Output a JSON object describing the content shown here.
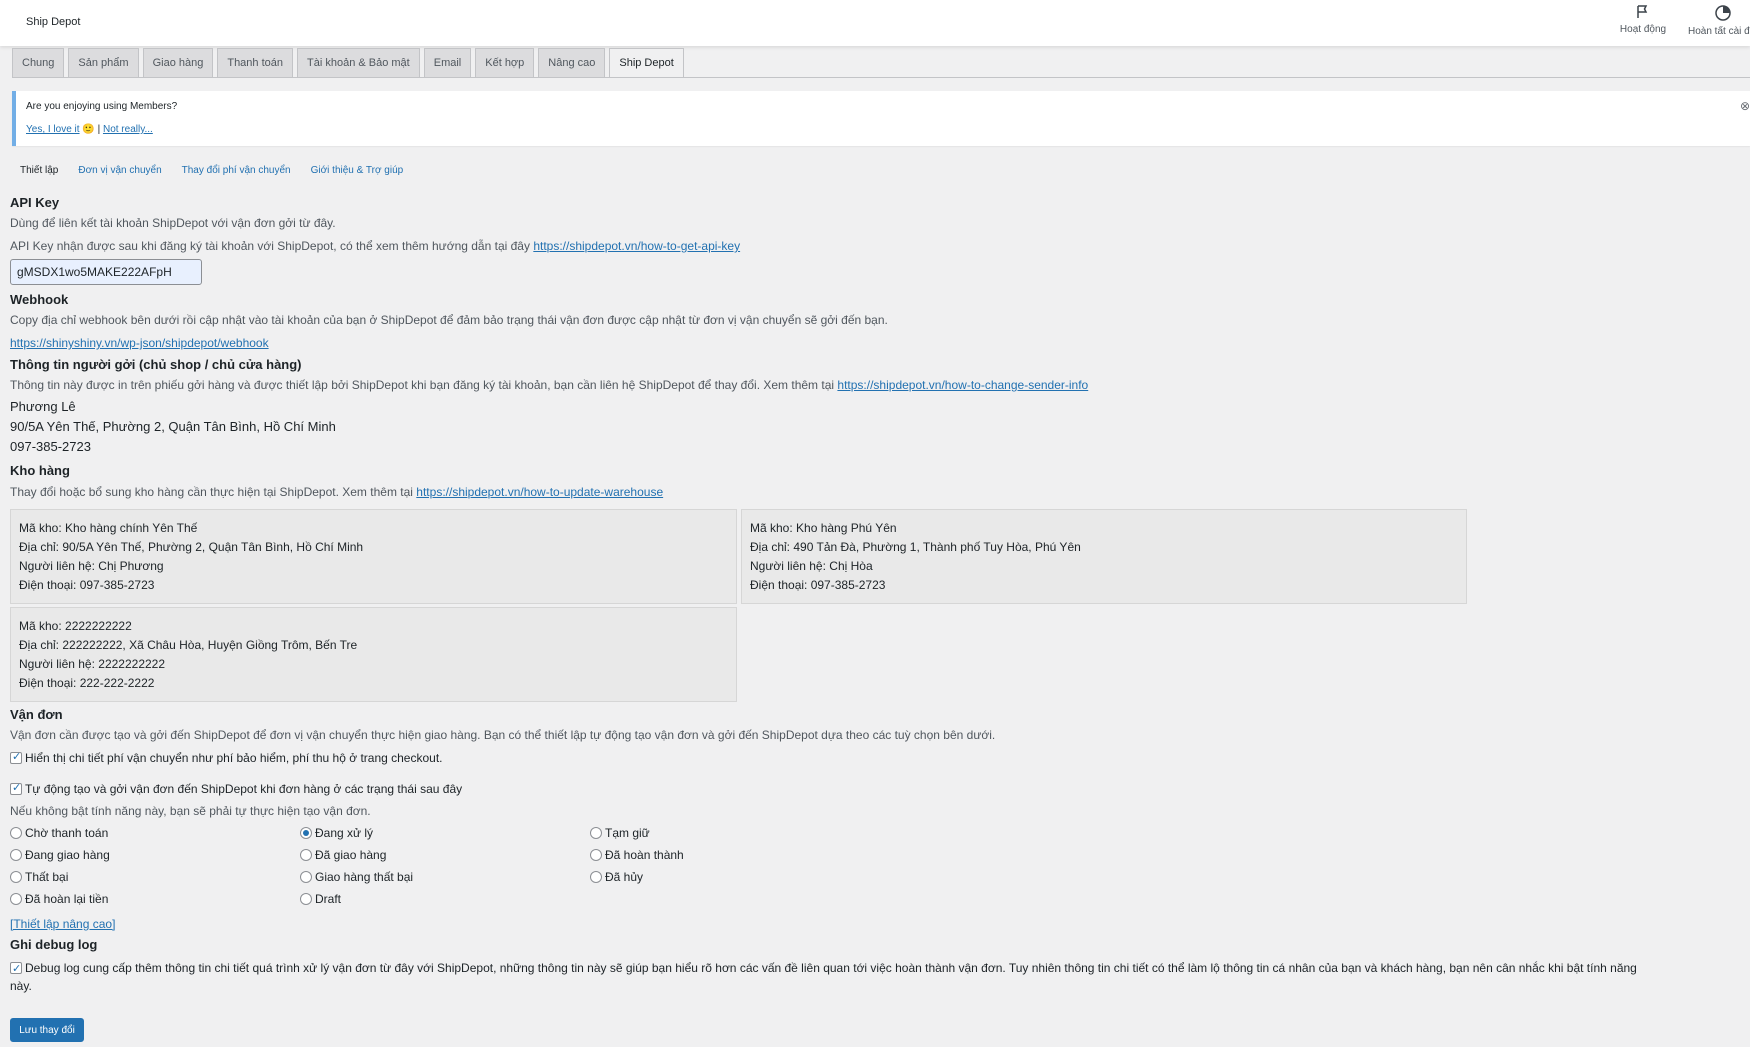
{
  "topbar": {
    "title": "Ship Depot",
    "activity_label": "Hoạt động",
    "finish_label": "Hoàn tất cài đ"
  },
  "tabs": [
    {
      "label": "Chung"
    },
    {
      "label": "Sản phẩm"
    },
    {
      "label": "Giao hàng"
    },
    {
      "label": "Thanh toán"
    },
    {
      "label": "Tài khoản & Bảo mật"
    },
    {
      "label": "Email"
    },
    {
      "label": "Kết hợp"
    },
    {
      "label": "Nâng cao"
    },
    {
      "label": "Ship Depot"
    }
  ],
  "notice": {
    "question": "Are you enjoying using Members?",
    "yes": "Yes, I love it",
    "emoji": "🙂",
    "sep": "|",
    "no": "Not really..."
  },
  "subnav": [
    "Thiết lập",
    "Đơn vị vận chuyển",
    "Thay đổi phí vận chuyển",
    "Giới thiệu & Trợ giúp"
  ],
  "api": {
    "heading": "API Key",
    "desc1": "Dùng để liên kết tài khoản ShipDepot với vận đơn gởi từ đây.",
    "desc2": "API Key nhận được sau khi đăng ký tài khoản với ShipDepot, có thể xem thêm hướng dẫn tại đây",
    "link": "https://shipdepot.vn/how-to-get-api-key",
    "value": "gMSDX1wo5MAKE222AFpH"
  },
  "webhook": {
    "heading": "Webhook",
    "desc": "Copy địa chỉ webhook bên dưới rồi cập nhật vào tài khoản của bạn ở ShipDepot để đảm bảo trạng thái vận đơn được cập nhật từ đơn vị vận chuyển sẽ gởi đến bạn.",
    "link": "https://shinyshiny.vn/wp-json/shipdepot/webhook"
  },
  "sender": {
    "heading": "Thông tin người gởi (chủ shop / chủ cửa hàng)",
    "desc": "Thông tin này được in trên phiếu gởi hàng và được thiết lập bởi ShipDepot khi bạn đăng ký tài khoản, bạn cần liên hệ ShipDepot để thay đổi. Xem thêm tại",
    "link": "https://shipdepot.vn/how-to-change-sender-info",
    "name": "Phương Lê",
    "address": "90/5A Yên Thế, Phường 2, Quận Tân Bình, Hồ Chí Minh",
    "phone": "097-385-2723"
  },
  "warehouse": {
    "heading": "Kho hàng",
    "desc": "Thay đổi hoặc bổ sung kho hàng cần thực hiện tại ShipDepot. Xem thêm tại",
    "link": "https://shipdepot.vn/how-to-update-warehouse",
    "items": [
      {
        "code": "Mã kho: Kho hàng chính Yên Thế",
        "address": "Địa chỉ: 90/5A Yên Thế, Phường 2, Quận Tân Bình, Hồ Chí Minh",
        "contact": "Người liên hệ: Chị Phương",
        "phone": "Điện thoại: 097-385-2723"
      },
      {
        "code": "Mã kho: Kho hàng Phú Yên",
        "address": "Địa chỉ: 490 Tản Đà, Phường 1, Thành phố Tuy Hòa, Phú Yên",
        "contact": "Người liên hệ: Chị Hòa",
        "phone": "Điện thoại: 097-385-2723"
      },
      {
        "code": "Mã kho: 2222222222",
        "address": "Địa chỉ: 222222222, Xã Châu Hòa, Huyện Giồng Trôm, Bến Tre",
        "contact": "Người liên hệ: 2222222222",
        "phone": "Điện thoại: 222-222-2222"
      }
    ]
  },
  "order": {
    "heading": "Vận đơn",
    "desc": "Vận đơn cần được tạo và gởi đến ShipDepot để đơn vị vận chuyển thực hiện giao hàng. Bạn có thể thiết lập tự động tạo vận đơn và gởi đến ShipDepot dựa theo các tuỳ chọn bên dưới.",
    "show_fee_label": "Hiển thị chi tiết phí vận chuyển như phí bảo hiểm, phí thu hộ ở trang checkout.",
    "auto_label": "Tự động tạo và gởi vận đơn đến ShipDepot khi đơn hàng ở các trạng thái sau đây",
    "auto_note": "Nếu không bật tính năng này, bạn sẽ phải tự thực hiện tạo vận đơn.",
    "statuses": [
      {
        "label": "Chờ thanh toán",
        "on": false
      },
      {
        "label": "Đang xử lý",
        "on": true
      },
      {
        "label": "Tạm giữ",
        "on": false
      },
      {
        "label": "Đang giao hàng",
        "on": false
      },
      {
        "label": "Đã giao hàng",
        "on": false
      },
      {
        "label": "Đã hoàn thành",
        "on": false
      },
      {
        "label": "Thất bại",
        "on": false
      },
      {
        "label": "Giao hàng thất bại",
        "on": false
      },
      {
        "label": "Đã hủy",
        "on": false
      },
      {
        "label": "Đã hoàn lại tiền",
        "on": false
      },
      {
        "label": "Draft",
        "on": false
      }
    ],
    "advanced_link": "[Thiết lập nâng cao]"
  },
  "debug": {
    "heading": "Ghi debug log",
    "line1": "Debug log cung cấp thêm thông tin chi tiết quá trình xử lý vận đơn từ đây với ShipDepot, những thông tin này sẽ giúp bạn hiểu rõ hơn các vấn đề liên quan tới việc hoàn thành vận đơn. Tuy nhiên thông tin chi tiết có thể làm lộ thông tin cá nhân của bạn và khách hàng, bạn nên cân nhắc khi bật tính năng",
    "line2": "này."
  },
  "save_button": "Lưu thay đổi",
  "colors": {
    "accent": "#2271b1",
    "tab_bg": "#dcdcde",
    "box_bg": "#e9e9e9"
  }
}
